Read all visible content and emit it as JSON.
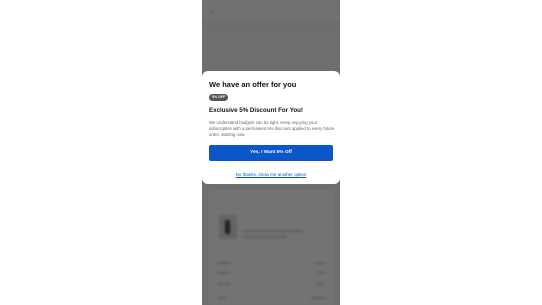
{
  "modal": {
    "title": "We have an offer for you",
    "badge": "5% OFF",
    "offer_title": "Exclusive 5% Discount For You!",
    "description": "We understand budgets can be tight. Keep enjoying your subscription with a permanent 5% discount applied to every future order, starting now.",
    "accept_label": "Yes, I Want 5% Off",
    "decline_label": "No thanks, show me another option"
  },
  "colors": {
    "accent": "#0a56c8",
    "badge_bg": "#555555",
    "overlay": "rgba(0,0,0,0.55)"
  }
}
